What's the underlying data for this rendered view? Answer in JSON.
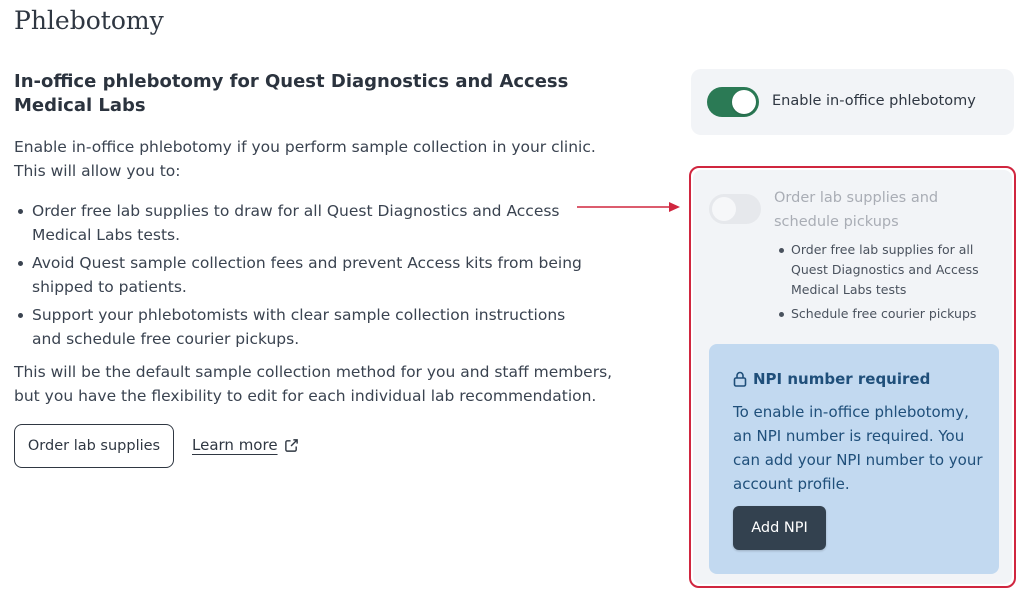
{
  "page": {
    "title": "Phlebotomy"
  },
  "section": {
    "title": "In-office phlebotomy for Quest Diagnostics and Access Medical Labs",
    "intro": "Enable in-office phlebotomy if you perform sample collection in your clinic. This will allow you to:",
    "bullets": [
      "Order free lab supplies to draw for all Quest Diagnostics and Access Medical Labs tests.",
      "Avoid Quest sample collection fees and prevent Access kits from being shipped to patients.",
      "Support your phlebotomists with clear sample collection instructions and schedule free courier pickups."
    ],
    "default_note": "This will be the default sample collection method for you and staff members, but you have the flexibility to edit for each individual lab recommendation."
  },
  "actions": {
    "order_label": "Order lab supplies",
    "learn_more_label": "Learn more"
  },
  "enable_toggle": {
    "label": "Enable in-office phlebotomy",
    "state": "on"
  },
  "supplies_toggle": {
    "label": "Order lab supplies and schedule pickups",
    "state": "off-disabled",
    "bullets": [
      "Order free lab supplies for all Quest Diagnostics and Access Medical Labs tests",
      "Schedule free courier pickups"
    ]
  },
  "npi_notice": {
    "title": "NPI number required",
    "text": "To enable in-office phlebotomy, an NPI number is required. You can add your NPI number to your account profile.",
    "button_label": "Add NPI"
  },
  "colors": {
    "toggle_on": "#2b7a55",
    "highlight_border": "#d0263f",
    "arrow": "#d0263f",
    "npi_background": "#c2d9f0",
    "npi_text": "#1f4f7a",
    "primary_button": "#33414f"
  },
  "icons": {
    "external_link": "external-link-icon",
    "lock": "lock-icon",
    "arrow": "arrow-right-icon"
  }
}
